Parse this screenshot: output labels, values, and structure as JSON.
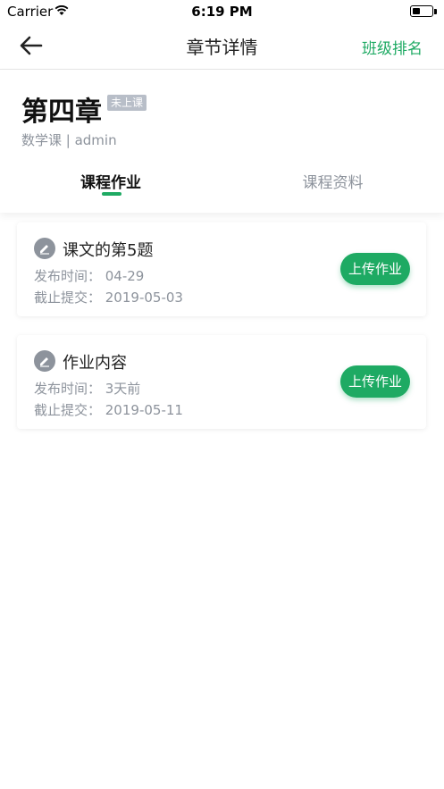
{
  "status_bar": {
    "carrier": "Carrier",
    "time": "6:19 PM"
  },
  "nav": {
    "title": "章节详情",
    "action": "班级排名"
  },
  "chapter": {
    "title": "第四章",
    "badge": "未上课",
    "meta": "数学课 | admin"
  },
  "tabs": [
    {
      "label": "课程作业",
      "active": true
    },
    {
      "label": "课程资料",
      "active": false
    }
  ],
  "assignments": [
    {
      "title": "课文的第5题",
      "published": "发布时间：  04-29",
      "deadline": "截止提交：  2019-05-03",
      "button": "上传作业"
    },
    {
      "title": "作业内容",
      "published": "发布时间：  3天前",
      "deadline": "截止提交：  2019-05-11",
      "button": "上传作业"
    }
  ],
  "colors": {
    "accent": "#1eaa63",
    "muted": "#8d939c",
    "badge": "#b8bec8"
  },
  "icons": {
    "back": "arrow-left-icon",
    "assignment": "pencil-icon"
  }
}
